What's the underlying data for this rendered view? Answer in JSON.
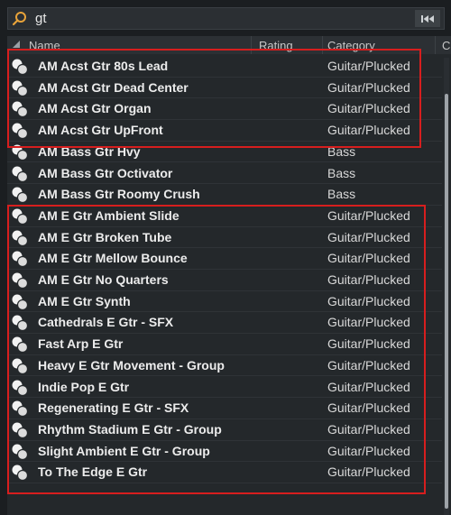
{
  "search": {
    "query": "gt"
  },
  "columns": {
    "name": "Name",
    "rating": "Rating",
    "category": "Category",
    "extra": "C"
  },
  "rows": [
    {
      "name": "AM Acst Gtr 80s Lead",
      "category": "Guitar/Plucked"
    },
    {
      "name": "AM Acst Gtr Dead Center",
      "category": "Guitar/Plucked"
    },
    {
      "name": "AM Acst Gtr Organ",
      "category": "Guitar/Plucked"
    },
    {
      "name": "AM Acst Gtr UpFront",
      "category": "Guitar/Plucked"
    },
    {
      "name": "AM Bass Gtr Hvy",
      "category": "Bass"
    },
    {
      "name": "AM Bass Gtr Octivator",
      "category": "Bass"
    },
    {
      "name": "AM Bass Gtr Roomy Crush",
      "category": "Bass"
    },
    {
      "name": "AM E Gtr Ambient Slide",
      "category": "Guitar/Plucked"
    },
    {
      "name": "AM E Gtr Broken Tube",
      "category": "Guitar/Plucked"
    },
    {
      "name": "AM E Gtr Mellow Bounce",
      "category": "Guitar/Plucked"
    },
    {
      "name": "AM E Gtr No Quarters",
      "category": "Guitar/Plucked"
    },
    {
      "name": "AM E Gtr Synth",
      "category": "Guitar/Plucked"
    },
    {
      "name": "Cathedrals E Gtr - SFX",
      "category": "Guitar/Plucked"
    },
    {
      "name": "Fast Arp E Gtr",
      "category": "Guitar/Plucked"
    },
    {
      "name": "Heavy E Gtr Movement - Group",
      "category": "Guitar/Plucked"
    },
    {
      "name": "Indie Pop E Gtr",
      "category": "Guitar/Plucked"
    },
    {
      "name": "Regenerating E Gtr - SFX",
      "category": "Guitar/Plucked"
    },
    {
      "name": "Rhythm Stadium E Gtr - Group",
      "category": "Guitar/Plucked"
    },
    {
      "name": "Slight Ambient E Gtr - Group",
      "category": "Guitar/Plucked"
    },
    {
      "name": "To The Edge E Gtr",
      "category": "Guitar/Plucked"
    }
  ],
  "colors": {
    "highlight": "#d71e1e",
    "accent": "#e8a33a"
  }
}
